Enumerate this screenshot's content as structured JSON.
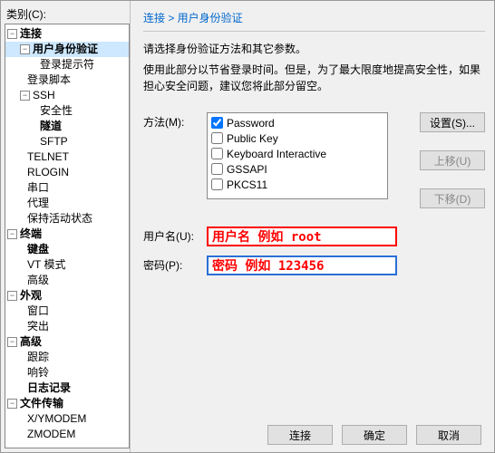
{
  "left": {
    "category_label": "类别(C):",
    "tree": {
      "conn": "连接",
      "auth": "用户身份验证",
      "login_prompt": "登录提示符",
      "login_script": "登录脚本",
      "ssh": "SSH",
      "security": "安全性",
      "tunnel": "隧道",
      "sftp": "SFTP",
      "telnet": "TELNET",
      "rlogin": "RLOGIN",
      "serial": "串口",
      "proxy": "代理",
      "keepalive": "保持活动状态",
      "terminal": "终端",
      "keyboard": "键盘",
      "vt": "VT 模式",
      "advanced1": "高级",
      "appearance": "外观",
      "window": "窗口",
      "highlight": "突出",
      "advanced2": "高级",
      "trace": "跟踪",
      "bell": "响铃",
      "log": "日志记录",
      "file_transfer": "文件传输",
      "xymodem": "X/YMODEM",
      "zmodem": "ZMODEM"
    }
  },
  "right": {
    "breadcrumb": "连接 > 用户身份验证",
    "instr1": "请选择身份验证方法和其它参数。",
    "instr2": "使用此部分以节省登录时间。但是，为了最大限度地提高安全性，如果担心安全问题，建议您将此部分留空。",
    "method_label": "方法(M):",
    "methods": {
      "password": "Password",
      "publickey": "Public Key",
      "keyboard": "Keyboard Interactive",
      "gssapi": "GSSAPI",
      "pkcs11": "PKCS11"
    },
    "btn_setup": "设置(S)...",
    "btn_up": "上移(U)",
    "btn_down": "下移(D)",
    "user_label": "用户名(U):",
    "user_value": "用户名 例如 root",
    "pass_label": "密码(P):",
    "pass_value": "密码 例如 123456",
    "btn_connect": "连接",
    "btn_ok": "确定",
    "btn_cancel": "取消"
  }
}
